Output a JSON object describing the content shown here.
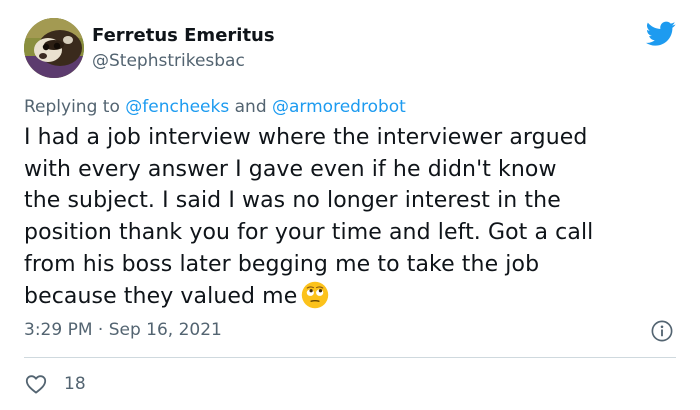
{
  "author": {
    "display_name": "Ferretus Emeritus",
    "handle": "@Stephstrikesbac"
  },
  "icons": {
    "brand": "twitter-bird-icon",
    "info": "info-icon",
    "like": "heart-icon",
    "emoji": "face-with-rolling-eyes-emoji"
  },
  "colors": {
    "brand_blue": "#1d9bf0",
    "text_primary": "#0f1419",
    "text_secondary": "#536471",
    "divider": "#cfd9de"
  },
  "reply": {
    "prefix": "Replying to",
    "mention_1": "@fencheeks",
    "conjunction": "and",
    "mention_2": "@armoredrobot"
  },
  "tweet": {
    "lines": [
      "I had a job interview where the interviewer argued",
      "with every answer I gave even if he didn't know",
      "the subject. I said I was no longer interest in the",
      "position thank you for your time and left. Got a call",
      "from his boss later begging me to take the job",
      "because they valued me"
    ]
  },
  "meta": {
    "timestamp": "3:29 PM · Sep 16, 2021"
  },
  "engagement": {
    "likes": "18"
  }
}
